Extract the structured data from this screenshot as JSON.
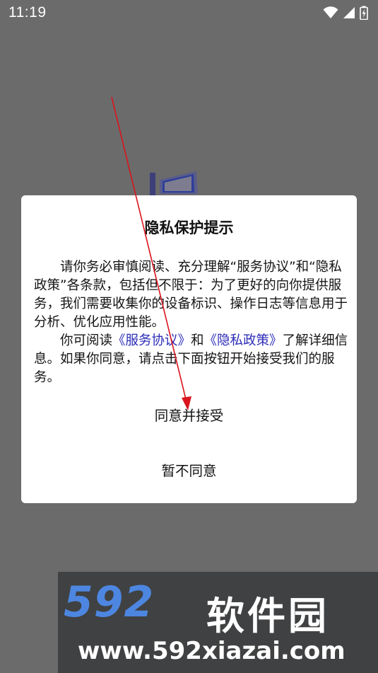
{
  "status_bar": {
    "time": "11:19",
    "icons": [
      "wifi-icon",
      "signal-icon",
      "battery-icon"
    ]
  },
  "dialog": {
    "title": "隐私保护提示",
    "paragraph1": "请你务必审慎阅读、充分理解“服务协议”和“隐私政策”各条款，包括但不限于：为了更好的向你提供服务，我们需要收集你的设备标识、操作日志等信息用于分析、优化应用性能。",
    "paragraph2_prefix": "你可阅读",
    "service_link": "《服务协议》",
    "and_text": "和",
    "privacy_link": "《隐私政策》",
    "paragraph2_suffix": "了解详细信息。如果你同意，请点击下面按钮开始接受我们的服务。",
    "agree_button": "同意并接受",
    "disagree_button": "暂不同意"
  },
  "watermark": {
    "logo": "592",
    "name": "软件园",
    "url": "www.592xiazai.com"
  },
  "colors": {
    "overlay": "#6b6b6b",
    "link": "#2c2cb8",
    "arrow": "#d9141e",
    "watermark_blue": "#4d86e0"
  }
}
